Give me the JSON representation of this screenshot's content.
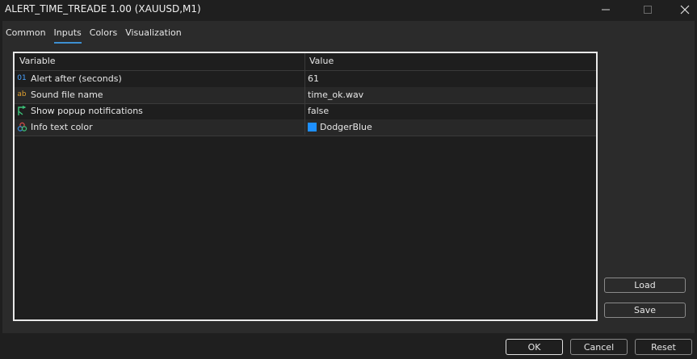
{
  "window": {
    "title": "ALERT_TIME_TREADE 1.00 (XAUUSD,M1)"
  },
  "tabs": [
    {
      "label": "Common",
      "active": false
    },
    {
      "label": "Inputs",
      "active": true
    },
    {
      "label": "Colors",
      "active": false
    },
    {
      "label": "Visualization",
      "active": false
    }
  ],
  "grid": {
    "headers": {
      "variable": "Variable",
      "value": "Value"
    },
    "rows": [
      {
        "icon": "integer-icon",
        "icon_text": "01",
        "icon_color": "#4aa3ff",
        "name": "Alert after (seconds)",
        "value": "61"
      },
      {
        "icon": "string-icon",
        "icon_text": "ab",
        "icon_color": "#e0a030",
        "name": "Sound file name",
        "value": "time_ok.wav"
      },
      {
        "icon": "boolean-icon",
        "icon_text": "",
        "icon_color": "#3cc47a",
        "name": "Show popup notifications",
        "value": "false"
      },
      {
        "icon": "color-icon",
        "icon_text": "",
        "icon_color": "#d64f8a",
        "name": "Info text color",
        "value": "DodgerBlue",
        "swatch": "#1e90ff"
      }
    ]
  },
  "side_buttons": {
    "load": "Load",
    "save": "Save"
  },
  "footer": {
    "ok": "OK",
    "cancel": "Cancel",
    "reset": "Reset"
  }
}
